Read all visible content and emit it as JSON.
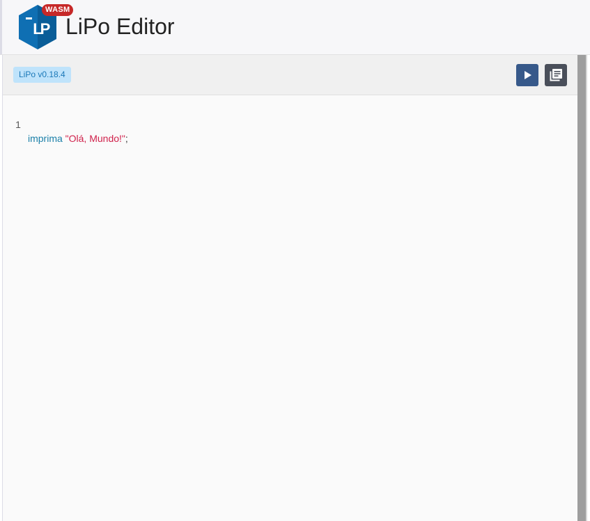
{
  "header": {
    "logo_text": "LiPo",
    "badge": "WASM",
    "title": "LiPo Editor"
  },
  "toolbar": {
    "version": "LiPo v0.18.4",
    "run_icon": "play-icon",
    "docs_icon": "library-books-icon"
  },
  "editor": {
    "lines": [
      {
        "number": "1",
        "keyword": "imprima",
        "string": "\"Olá, Mundo!\"",
        "terminator": ";"
      }
    ]
  },
  "colors": {
    "badge": "#c62828",
    "logo": "#0f6fb3",
    "run_button": "#37598a",
    "docs_button": "#4a4f5a",
    "keyword": "#1a7fa8",
    "string": "#d0214b",
    "version_chip_bg": "#bfe3fb",
    "version_chip_text": "#1a78b8"
  }
}
